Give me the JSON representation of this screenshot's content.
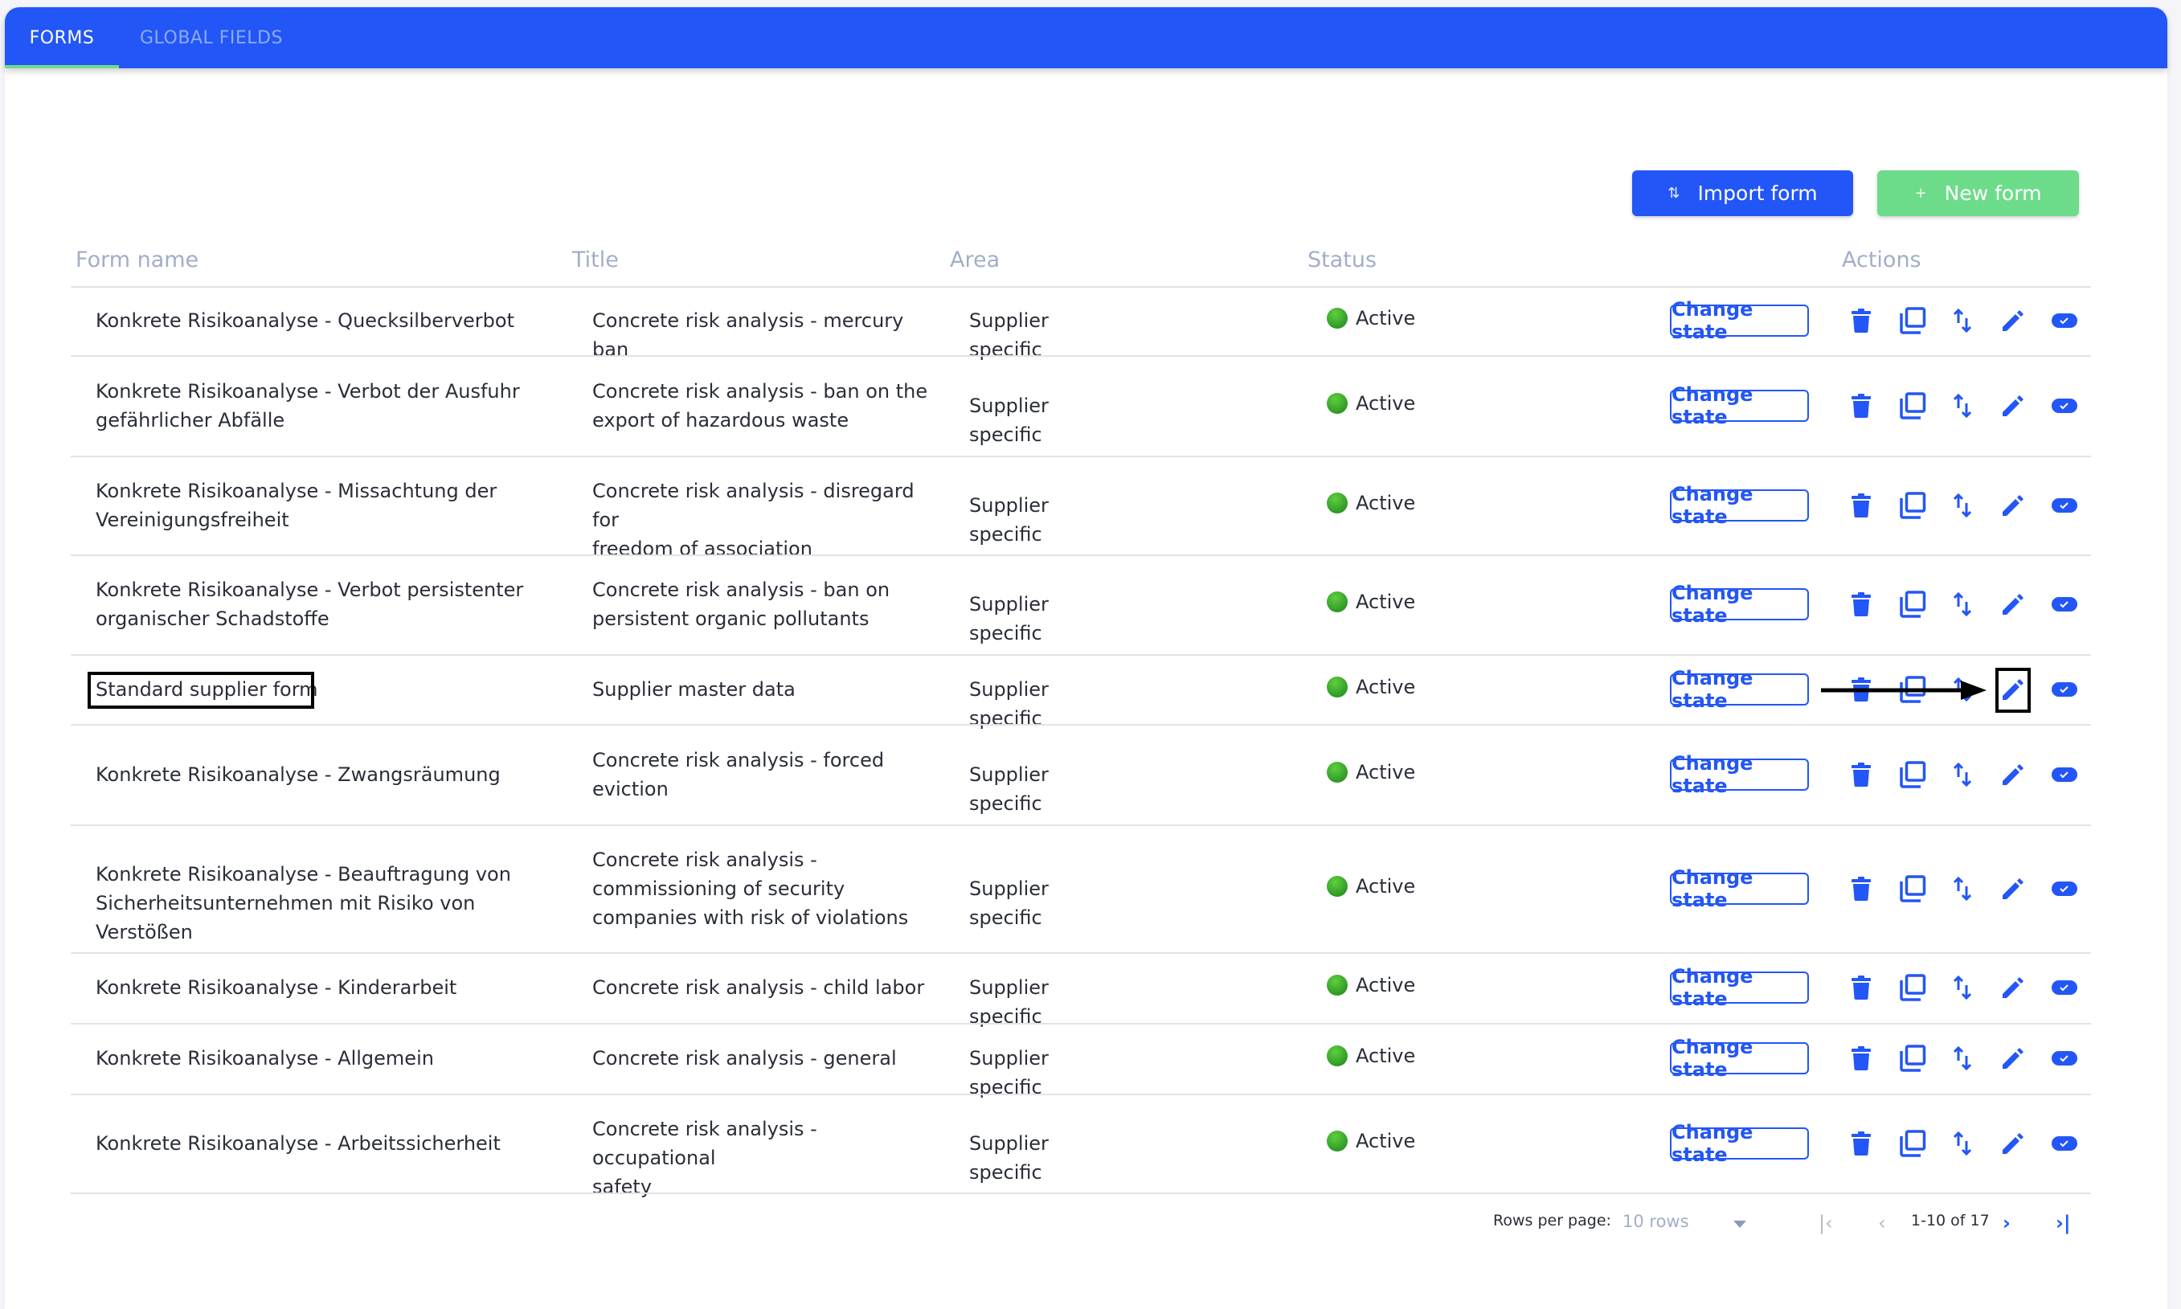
{
  "tabs": [
    {
      "label": "FORMS",
      "active": true
    },
    {
      "label": "GLOBAL FIELDS",
      "active": false
    }
  ],
  "toolbar": {
    "import_label": "Import form",
    "import_icon": "import-arrows-icon",
    "new_label": "New form",
    "new_icon": "plus-icon"
  },
  "table": {
    "headers": {
      "form_name": "Form name",
      "title": "Title",
      "area": "Area",
      "status": "Status",
      "actions": "Actions"
    },
    "change_state_label": "Change state",
    "action_icons": [
      "trash-icon",
      "duplicate-icon",
      "export-arrows-icon",
      "edit-pencil-icon",
      "toggle-check-icon"
    ],
    "rows": [
      {
        "form_name": [
          "Konkrete Risikoanalyse - Quecksilberverbot"
        ],
        "title": [
          "Concrete risk analysis - mercury ban"
        ],
        "area": "Supplier specific",
        "status": "Active"
      },
      {
        "form_name": [
          "Konkrete Risikoanalyse - Verbot der Ausfuhr",
          "gefährlicher Abfälle"
        ],
        "title": [
          "Concrete risk analysis - ban on the",
          "export of hazardous waste"
        ],
        "area": "Supplier specific",
        "status": "Active"
      },
      {
        "form_name": [
          "Konkrete Risikoanalyse - Missachtung der",
          "Vereinigungsfreiheit"
        ],
        "title": [
          "Concrete risk analysis - disregard for",
          "freedom of association"
        ],
        "area": "Supplier specific",
        "status": "Active"
      },
      {
        "form_name": [
          "Konkrete Risikoanalyse - Verbot persistenter",
          "organischer Schadstoffe"
        ],
        "title": [
          "Concrete risk analysis - ban on",
          "persistent organic pollutants"
        ],
        "area": "Supplier specific",
        "status": "Active"
      },
      {
        "form_name": [
          "Standard supplier form"
        ],
        "title": [
          "Supplier master data"
        ],
        "area": "Supplier specific",
        "status": "Active",
        "highlighted": true
      },
      {
        "form_name": [
          "Konkrete Risikoanalyse - Zwangsräumung"
        ],
        "title": [
          "Concrete risk analysis - forced",
          "eviction"
        ],
        "area": "Supplier specific",
        "status": "Active"
      },
      {
        "form_name": [
          "Konkrete Risikoanalyse - Beauftragung von",
          "Sicherheitsunternehmen mit Risiko von Verstößen"
        ],
        "title": [
          "Concrete risk analysis -",
          "commissioning of security",
          "companies with risk of violations"
        ],
        "area": "Supplier specific",
        "status": "Active"
      },
      {
        "form_name": [
          "Konkrete Risikoanalyse - Kinderarbeit"
        ],
        "title": [
          "Concrete risk analysis - child labor"
        ],
        "area": "Supplier specific",
        "status": "Active"
      },
      {
        "form_name": [
          "Konkrete Risikoanalyse - Allgemein"
        ],
        "title": [
          "Concrete risk analysis - general"
        ],
        "area": "Supplier specific",
        "status": "Active"
      },
      {
        "form_name": [
          "Konkrete Risikoanalyse - Arbeitssicherheit"
        ],
        "title": [
          "Concrete risk analysis - occupational",
          "safety"
        ],
        "area": "Supplier specific",
        "status": "Active"
      }
    ]
  },
  "pagination": {
    "rows_per_page_label": "Rows per page:",
    "rows_per_page_value": "10 rows",
    "range": "1-10 of 17",
    "first_icon": "first-page-icon",
    "prev_icon": "prev-page-icon",
    "next_icon": "next-page-icon",
    "last_icon": "last-page-icon"
  },
  "annotation": {
    "highlighted_cell": "Standard supplier form",
    "highlighted_action": "edit-pencil-icon"
  },
  "colors": {
    "primary": "#2356f6",
    "success": "#6ddc8a",
    "header_text": "#a2aec8",
    "status_active": "#3aa82e"
  }
}
